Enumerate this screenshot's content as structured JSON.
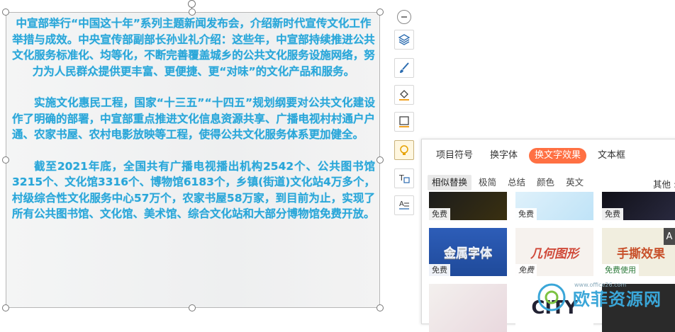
{
  "document": {
    "paragraphs": [
      "中宣部举行“中国这十年”系列主题新闻发布会，介绍新时代宣传文化工作举措与成效。中央宣传部副部长孙业礼介绍：这些年，中宣部持续推进公共文化服务标准化、均等化，不断完善覆盖城乡的公共文化服务设施网络，努力为人民群众提供更丰富、更便捷、更“对味”的文化产品和服务。",
      "实施文化惠民工程，国家“十三五”“十四五”规划纲要对公共文化建设作了明确的部署，中宣部重点推进文化信息资源共享、广播电视村村通户户通、农家书屋、农村电影放映等工程，使得公共文化服务体系更加健全。",
      "截至2021年底，全国共有广播电视播出机构2542个、公共图书馆3215个、文化馆3316个、博物馆6183个，乡镇(街道)文化站4万多个，村级综合性文化服务中心57万个，农家书屋58万家，到目前为止，实现了所有公共图书馆、文化馆、美术馆、综合文化站和大部分博物馆免费开放。"
    ]
  },
  "side_toolbar": {
    "buttons": [
      "collapse-icon",
      "layers-icon",
      "brush-icon",
      "fill-bucket-icon",
      "outline-icon",
      "text-effect-icon",
      "text-wrap-icon",
      "text-direction-icon"
    ]
  },
  "panel": {
    "tabs": [
      "项目符号",
      "换字体",
      "换文字效果",
      "文本框"
    ],
    "active_tab": "换文字效果",
    "subtabs": [
      "相似替换",
      "极简",
      "总结",
      "颜色",
      "英文"
    ],
    "more_label": "其他 :",
    "cards": [
      {
        "title": "",
        "badge": "免费"
      },
      {
        "title": "",
        "badge": "免费"
      },
      {
        "title": "",
        "badge": "免费"
      },
      {
        "title": "金属字体",
        "badge": "免费"
      },
      {
        "title": "几何图形",
        "badge": "免费"
      },
      {
        "title": "手撕效果",
        "badge": "免费使用"
      },
      {
        "title": "",
        "badge": ""
      },
      {
        "title": "CITY",
        "badge": ""
      },
      {
        "title": "",
        "badge": ""
      }
    ],
    "scroll_label": "A"
  },
  "watermark": {
    "text": "欧菲资源网",
    "url": "www.office26.com"
  },
  "colors": {
    "text_blue": "#2aa6d8",
    "accent_orange": "#ff7043"
  }
}
